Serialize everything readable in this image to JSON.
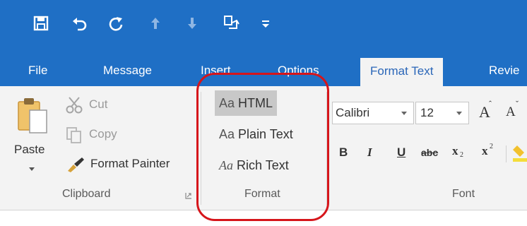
{
  "quick_access": {
    "icons": [
      "save-icon",
      "undo-icon",
      "redo-icon",
      "up-arrow-icon",
      "down-arrow-icon",
      "copy-move-icon",
      "customize-dropdown-icon"
    ]
  },
  "tabs": [
    {
      "label": "File",
      "active": false
    },
    {
      "label": "Message",
      "active": false
    },
    {
      "label": "Insert",
      "active": false
    },
    {
      "label": "Options",
      "active": false
    },
    {
      "label": "Format Text",
      "active": true
    },
    {
      "label": "Revie",
      "active": false
    }
  ],
  "clipboard": {
    "paste_label": "Paste",
    "cut_label": "Cut",
    "copy_label": "Copy",
    "format_painter_label": "Format Painter",
    "group_label": "Clipboard"
  },
  "format": {
    "html_prefix": "Aa",
    "html_label": "HTML",
    "plain_prefix": "Aa",
    "plain_label": "Plain Text",
    "rich_prefix": "Aa",
    "rich_label": "Rich Text",
    "group_label": "Format",
    "selected": "HTML"
  },
  "font": {
    "font_name": "Calibri",
    "font_size": "12",
    "grow_label": "A",
    "shrink_label": "A",
    "bold_label": "B",
    "italic_label": "I",
    "underline_label": "U",
    "strike_label": "abc",
    "subscript_label": "x",
    "subscript_mark": "2",
    "superscript_label": "x",
    "superscript_mark": "2",
    "group_label": "Font"
  },
  "colors": {
    "title_bar": "#1f6fc5",
    "ribbon": "#f3f3f3",
    "active_tab_text": "#2a66b8",
    "annotation": "#d6151b"
  }
}
